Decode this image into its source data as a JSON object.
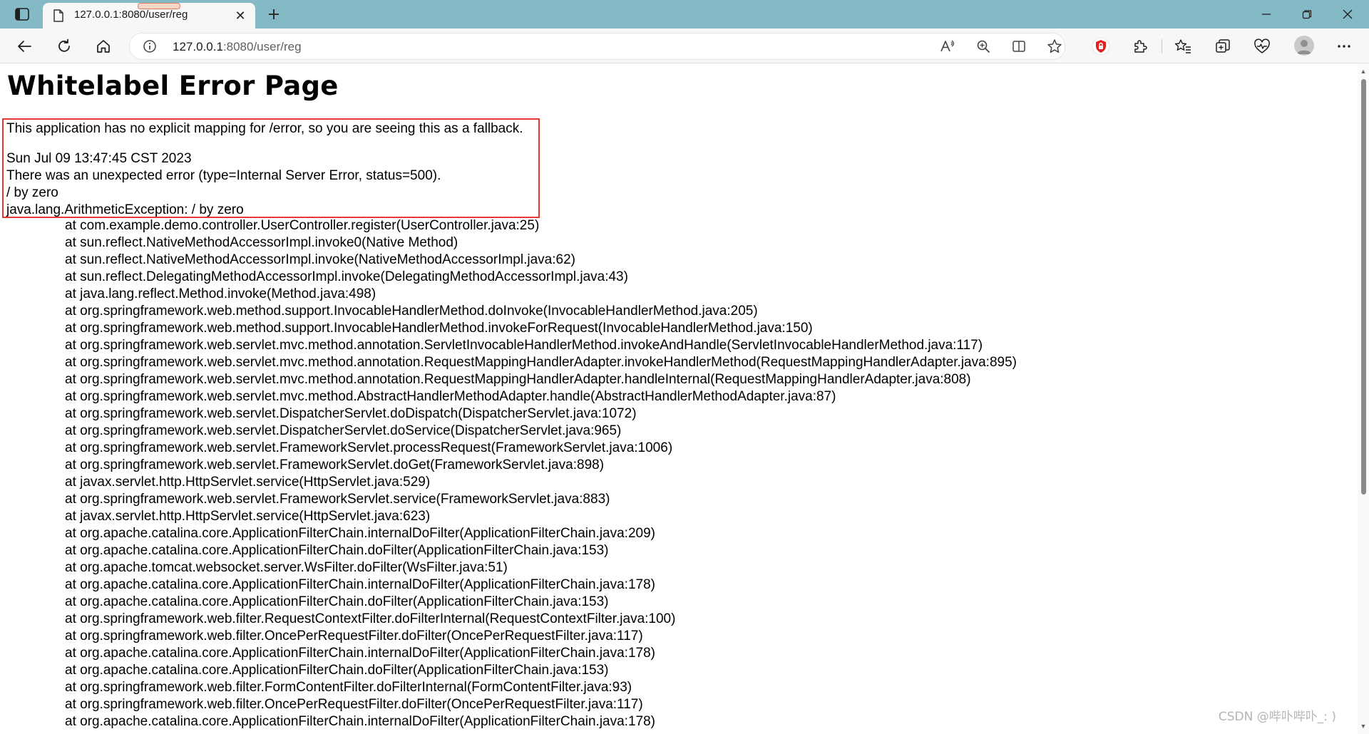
{
  "browser": {
    "tab": {
      "title": "127.0.0.1:8080/user/reg",
      "close_glyph": "✕"
    },
    "new_tab_glyph": "+",
    "address": {
      "host": "127.0.0.1",
      "rest": ":8080/user/reg"
    },
    "window_controls": {
      "minimize": "—",
      "restore": "❐",
      "close": "✕"
    },
    "icons": {
      "back": "back-arrow-icon",
      "refresh": "refresh-icon",
      "home": "home-icon",
      "info": "info-icon",
      "read_aloud": "read-aloud-icon",
      "zoom": "zoom-icon",
      "split_screen": "split-screen-icon",
      "favorite": "star-icon",
      "extension_shield": "shield-extension-icon",
      "extensions": "puzzle-icon",
      "favorites": "favorites-icon",
      "collections": "collections-icon",
      "performance": "heart-pulse-icon",
      "profile": "avatar",
      "more": "more-icon"
    },
    "colors": {
      "tabstrip": "#84b9c6",
      "toolbar": "#f7f7f7",
      "highlight": "#e53935",
      "shield": "#e02424"
    }
  },
  "page": {
    "title": "Whitelabel Error Page",
    "message": "This application has no explicit mapping for /error, so you are seeing this as a fallback.",
    "timestamp": "Sun Jul 09 13:47:45 CST 2023",
    "error_summary": "There was an unexpected error (type=Internal Server Error, status=500).",
    "error_message": "/ by zero",
    "exception": "java.lang.ArithmeticException: / by zero",
    "stack_trace": [
      "at com.example.demo.controller.UserController.register(UserController.java:25)",
      "at sun.reflect.NativeMethodAccessorImpl.invoke0(Native Method)",
      "at sun.reflect.NativeMethodAccessorImpl.invoke(NativeMethodAccessorImpl.java:62)",
      "at sun.reflect.DelegatingMethodAccessorImpl.invoke(DelegatingMethodAccessorImpl.java:43)",
      "at java.lang.reflect.Method.invoke(Method.java:498)",
      "at org.springframework.web.method.support.InvocableHandlerMethod.doInvoke(InvocableHandlerMethod.java:205)",
      "at org.springframework.web.method.support.InvocableHandlerMethod.invokeForRequest(InvocableHandlerMethod.java:150)",
      "at org.springframework.web.servlet.mvc.method.annotation.ServletInvocableHandlerMethod.invokeAndHandle(ServletInvocableHandlerMethod.java:117)",
      "at org.springframework.web.servlet.mvc.method.annotation.RequestMappingHandlerAdapter.invokeHandlerMethod(RequestMappingHandlerAdapter.java:895)",
      "at org.springframework.web.servlet.mvc.method.annotation.RequestMappingHandlerAdapter.handleInternal(RequestMappingHandlerAdapter.java:808)",
      "at org.springframework.web.servlet.mvc.method.AbstractHandlerMethodAdapter.handle(AbstractHandlerMethodAdapter.java:87)",
      "at org.springframework.web.servlet.DispatcherServlet.doDispatch(DispatcherServlet.java:1072)",
      "at org.springframework.web.servlet.DispatcherServlet.doService(DispatcherServlet.java:965)",
      "at org.springframework.web.servlet.FrameworkServlet.processRequest(FrameworkServlet.java:1006)",
      "at org.springframework.web.servlet.FrameworkServlet.doGet(FrameworkServlet.java:898)",
      "at javax.servlet.http.HttpServlet.service(HttpServlet.java:529)",
      "at org.springframework.web.servlet.FrameworkServlet.service(FrameworkServlet.java:883)",
      "at javax.servlet.http.HttpServlet.service(HttpServlet.java:623)",
      "at org.apache.catalina.core.ApplicationFilterChain.internalDoFilter(ApplicationFilterChain.java:209)",
      "at org.apache.catalina.core.ApplicationFilterChain.doFilter(ApplicationFilterChain.java:153)",
      "at org.apache.tomcat.websocket.server.WsFilter.doFilter(WsFilter.java:51)",
      "at org.apache.catalina.core.ApplicationFilterChain.internalDoFilter(ApplicationFilterChain.java:178)",
      "at org.apache.catalina.core.ApplicationFilterChain.doFilter(ApplicationFilterChain.java:153)",
      "at org.springframework.web.filter.RequestContextFilter.doFilterInternal(RequestContextFilter.java:100)",
      "at org.springframework.web.filter.OncePerRequestFilter.doFilter(OncePerRequestFilter.java:117)",
      "at org.apache.catalina.core.ApplicationFilterChain.internalDoFilter(ApplicationFilterChain.java:178)",
      "at org.apache.catalina.core.ApplicationFilterChain.doFilter(ApplicationFilterChain.java:153)",
      "at org.springframework.web.filter.FormContentFilter.doFilterInternal(FormContentFilter.java:93)",
      "at org.springframework.web.filter.OncePerRequestFilter.doFilter(OncePerRequestFilter.java:117)",
      "at org.apache.catalina.core.ApplicationFilterChain.internalDoFilter(ApplicationFilterChain.java:178)"
    ]
  },
  "watermark": "CSDN @哔卟哔卟_: )"
}
